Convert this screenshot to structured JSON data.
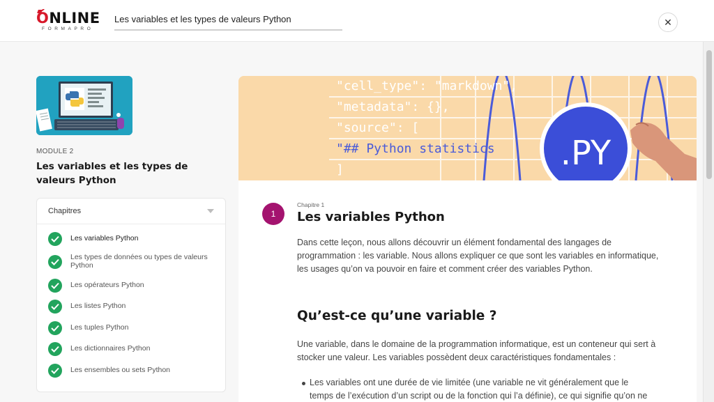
{
  "logo": {
    "main_o": "Ó",
    "main_rest": "NLINE",
    "sub": "FORMAPRO"
  },
  "header": {
    "title": "Les variables et les types de valeurs Python",
    "close_icon": "close-icon"
  },
  "module": {
    "label": "MODULE 2",
    "title": "Les variables et les types de valeurs Python",
    "thumbnail_icon": "python-laptop-illustration"
  },
  "chapters": {
    "heading": "Chapitres",
    "items": [
      {
        "label": "Les variables Python",
        "completed": true,
        "active": true
      },
      {
        "label": "Les types de données ou types de valeurs Python",
        "completed": true,
        "active": false
      },
      {
        "label": "Les opérateurs Python",
        "completed": true,
        "active": false
      },
      {
        "label": "Les listes Python",
        "completed": true,
        "active": false
      },
      {
        "label": "Les tuples Python",
        "completed": true,
        "active": false
      },
      {
        "label": "Les dictionnaires Python",
        "completed": true,
        "active": false
      },
      {
        "label": "Les ensembles ou sets Python",
        "completed": true,
        "active": false
      }
    ]
  },
  "hero": {
    "code_lines": [
      "\"cell_type\": \"markdown\",",
      "\"metadata\": {},",
      "\"source\": [",
      " \"## Python statistics",
      "]"
    ],
    "badge": ".PY",
    "colors": {
      "background": "#fad9a9",
      "code": "#ffffff",
      "keyword": "#4a5bd9",
      "badge": "#3b4ed8"
    }
  },
  "content": {
    "chapter_number": "1",
    "chapter_kicker": "Chapitre 1",
    "chapter_title": "Les variables Python",
    "intro_1": "Dans cette leçon, nous allons découvrir un élément fondamental des langages de",
    "intro_2": "programmation : les variable. Nous allons expliquer ce que sont les variables en informatique,",
    "intro_3": "les usages qu’on va pouvoir en faire et comment créer des variables Python.",
    "h2": "Qu’est-ce qu’une variable ?",
    "para_1": "Une variable, dans le domaine de la programmation informatique, est un conteneur qui sert à",
    "para_2": "stocker une valeur. Les variables possèdent deux caractéristiques fondamentales :",
    "bullet_1": "Les variables ont une durée de vie limitée (une variable ne vit généralement que le",
    "bullet_2": "temps de l’exécution d’un script ou de la fonction qui l’a définie), ce qui signifie qu’on ne"
  },
  "colors": {
    "accent_check": "#22a45d",
    "chapter_badge": "#a4136f",
    "brand_red": "#d7192b"
  }
}
